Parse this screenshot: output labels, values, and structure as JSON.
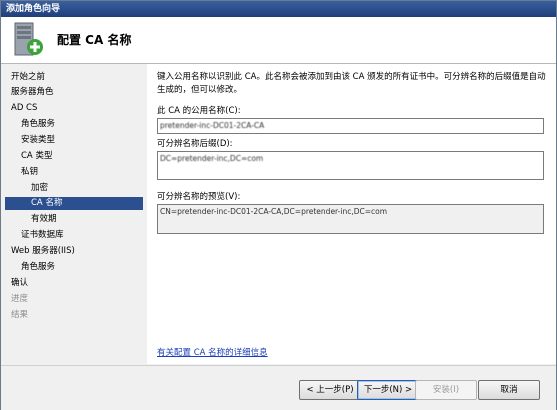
{
  "window": {
    "title": "添加角色向导"
  },
  "header": {
    "title": "配置 CA 名称"
  },
  "nav": {
    "items": [
      {
        "label": "开始之前",
        "state": "normal"
      },
      {
        "label": "服务器角色",
        "state": "normal"
      },
      {
        "label": "AD CS",
        "state": "normal"
      },
      {
        "label": "角色服务",
        "state": "normal"
      },
      {
        "label": "安装类型",
        "state": "normal"
      },
      {
        "label": "CA 类型",
        "state": "normal"
      },
      {
        "label": "私钥",
        "state": "normal"
      },
      {
        "label": "加密",
        "state": "normal"
      },
      {
        "label": "CA 名称",
        "state": "selected"
      },
      {
        "label": "有效期",
        "state": "normal"
      },
      {
        "label": "证书数据库",
        "state": "normal"
      },
      {
        "label": "Web 服务器(IIS)",
        "state": "normal"
      },
      {
        "label": "角色服务",
        "state": "normal"
      },
      {
        "label": "确认",
        "state": "normal"
      },
      {
        "label": "进度",
        "state": "dim"
      },
      {
        "label": "结果",
        "state": "dim"
      }
    ]
  },
  "main": {
    "description": "键入公用名称以识别此 CA。此名称会被添加到由该 CA 颁发的所有证书中。可分辨名称的后缀值是自动生成的，但可以修改。",
    "common_name_label": "此 CA 的公用名称(C):",
    "common_name_value": "pretender-inc-DC01-2CA-CA",
    "suffix_label": "可分辨名称后缀(D):",
    "suffix_value": "DC=pretender-inc,DC=com",
    "preview_label": "可分辨名称的预览(V):",
    "preview_value": "CN=pretender-inc-DC01-2CA-CA,DC=pretender-inc,DC=com",
    "help_link": "有关配置 CA 名称的详细信息"
  },
  "footer": {
    "prev": "< 上一步(P)",
    "next": "下一步(N) >",
    "install": "安装(I)",
    "cancel": "取消"
  },
  "colors": {
    "title_bar": "#1f3f7a",
    "selected_nav": "#2c4f8f",
    "link": "#1a3fb8"
  }
}
